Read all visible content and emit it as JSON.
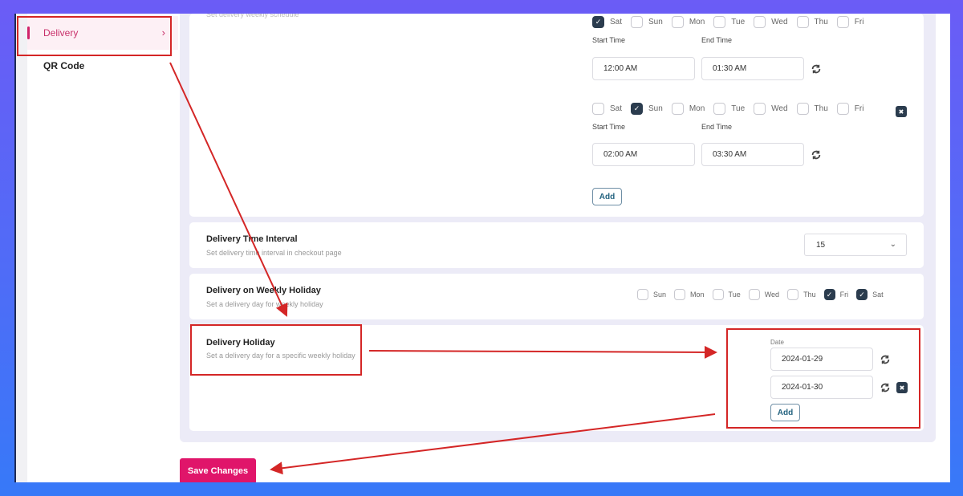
{
  "sidebar": {
    "items": [
      {
        "label": "Delivery",
        "active": true
      },
      {
        "label": "QR Code",
        "active": false
      }
    ]
  },
  "schedule": {
    "subtitle": "Set delivery weekly schedule",
    "days": [
      "Sat",
      "Sun",
      "Mon",
      "Tue",
      "Wed",
      "Thu",
      "Fri"
    ],
    "start_label": "Start Time",
    "end_label": "End Time",
    "slots": [
      {
        "checked": [
          "Sat"
        ],
        "start": "12:00 AM",
        "end": "01:30 AM",
        "removable": false
      },
      {
        "checked": [
          "Sun"
        ],
        "start": "02:00 AM",
        "end": "03:30 AM",
        "removable": true
      }
    ],
    "add_label": "Add"
  },
  "time_interval": {
    "title": "Delivery Time Interval",
    "description": "Set delivery time interval in checkout page",
    "value": "15"
  },
  "weekly_holiday": {
    "title": "Delivery on Weekly Holiday",
    "description": "Set a delivery day for weekly holiday",
    "days": [
      {
        "label": "Sun",
        "checked": false
      },
      {
        "label": "Mon",
        "checked": false
      },
      {
        "label": "Tue",
        "checked": false
      },
      {
        "label": "Wed",
        "checked": false
      },
      {
        "label": "Thu",
        "checked": false
      },
      {
        "label": "Fri",
        "checked": true
      },
      {
        "label": "Sat",
        "checked": true
      }
    ]
  },
  "holiday": {
    "title": "Delivery Holiday",
    "description": "Set a delivery day for a specific weekly holiday",
    "date_label": "Date",
    "dates": [
      "2024-01-29",
      "2024-01-30"
    ],
    "add_label": "Add"
  },
  "save_label": "Save Changes",
  "icons": {
    "check": "✓",
    "chevron_right": "›",
    "chevron_down": "⌄",
    "close": "✖"
  },
  "colors": {
    "accent": "#e0156a",
    "checkbox_checked": "#2b3c4e",
    "annotation": "#d42626"
  }
}
